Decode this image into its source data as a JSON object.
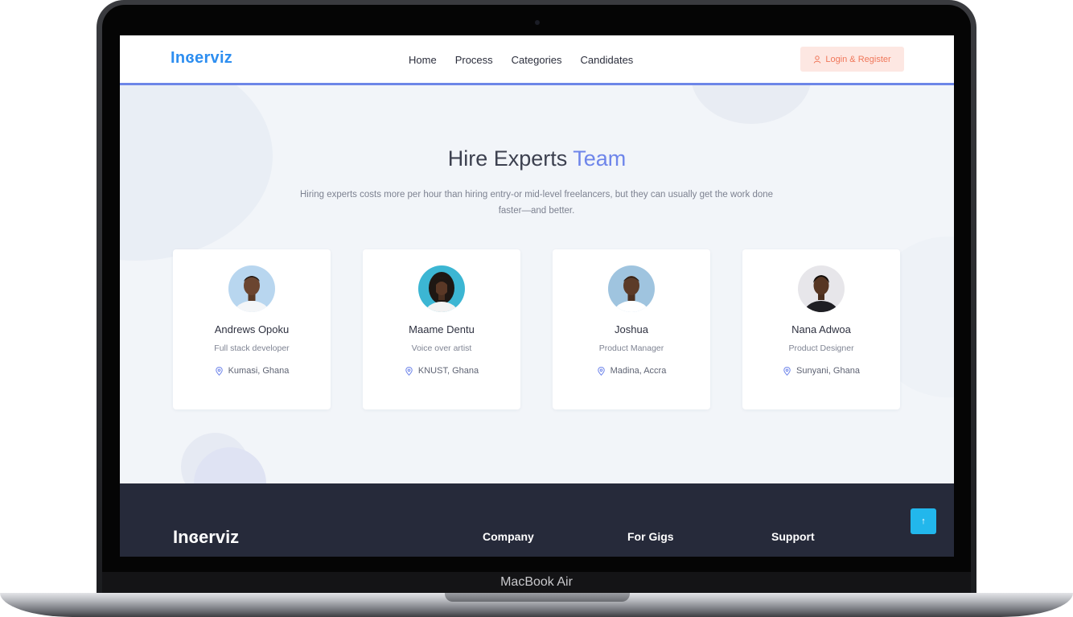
{
  "device": {
    "label": "MacBook Air"
  },
  "navbar": {
    "logo": "Inɞerviz",
    "links": [
      "Home",
      "Process",
      "Categories",
      "Candidates"
    ],
    "login_label": "Login & Register"
  },
  "hero": {
    "title_main": "Hire Experts",
    "title_accent": "Team",
    "description": "Hiring experts costs more per hour than hiring entry-or mid-level freelancers, but they can usually get the work done faster—and better."
  },
  "candidates": [
    {
      "name": "Andrews Opoku",
      "role": "Full stack developer",
      "location": "Kumasi, Ghana",
      "avatar_bg": "#b8d6ef",
      "shirt": "#f4f6f8"
    },
    {
      "name": "Maame Dentu",
      "role": "Voice over artist",
      "location": "KNUST, Ghana",
      "avatar_bg": "#3cb6d3",
      "shirt": "#f2f2f2"
    },
    {
      "name": "Joshua",
      "role": "Product Manager",
      "location": "Madina, Accra",
      "avatar_bg": "#9fc4df",
      "shirt": "#ffffff"
    },
    {
      "name": "Nana Adwoa",
      "role": "Product Designer",
      "location": "Sunyani, Ghana",
      "avatar_bg": "#e7e6ea",
      "shirt": "#1f1f24"
    }
  ],
  "footer": {
    "logo": "Inɞerviz",
    "headings": [
      "Company",
      "For Gigs",
      "Support"
    ]
  },
  "icons": {
    "login": "user-icon",
    "location": "map-pin-icon",
    "scroll_top": "arrow-up-icon"
  },
  "colors": {
    "brand": "#2d8ef0",
    "accent": "#6e85ea",
    "login_bg": "#fde7e2",
    "login_text": "#f0775a",
    "footer_bg": "#262a3a",
    "scroll_btn": "#22b7ec"
  }
}
